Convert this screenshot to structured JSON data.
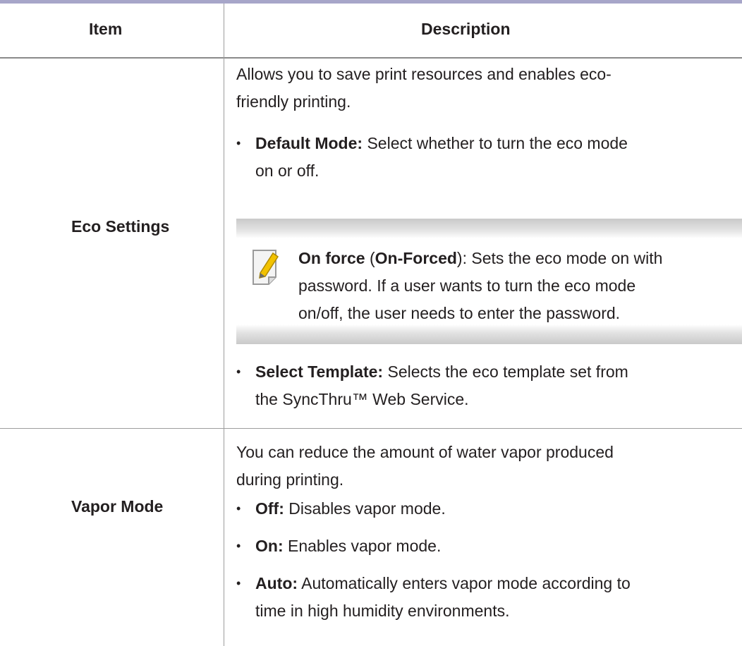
{
  "table": {
    "headers": {
      "item": "Item",
      "description": "Description"
    },
    "rows": [
      {
        "item": "Eco Settings",
        "intro_line1": "Allows you to save print resources and enables eco-",
        "intro_line2": "friendly printing.",
        "bullets": [
          {
            "term": "Default Mode:",
            "line1": " Select whether to turn the eco mode",
            "line2": "on or off."
          },
          {
            "term": "Select Template:",
            "line1": " Selects the eco template set from",
            "line2": "the SyncThru™ Web Service."
          }
        ],
        "note": {
          "icon": "note-pencil-icon",
          "term1": "On force",
          "paren_open": " (",
          "term2": "On-Forced",
          "line1_rest": "): Sets the eco mode on with",
          "line2": "password. If a user wants to turn the eco mode",
          "line3": "on/off, the user needs to enter the password."
        }
      },
      {
        "item": "Vapor Mode",
        "intro_line1": "You can reduce the amount of water vapor produced",
        "intro_line2": "during printing.",
        "bullets": [
          {
            "term": "Off:",
            "line1": " Disables vapor mode."
          },
          {
            "term": "On:",
            "line1": " Enables vapor mode."
          },
          {
            "term": "Auto:",
            "line1": " Automatically enters vapor mode according to",
            "line2": "time in high humidity environments."
          }
        ]
      }
    ],
    "bullet_char": "•"
  },
  "colors": {
    "top_rule": "#a7a6c9",
    "text": "#231f20",
    "divider": "#9d9d9d",
    "note_band": "#c9c9c9",
    "icon_accent": "#f2c200"
  }
}
